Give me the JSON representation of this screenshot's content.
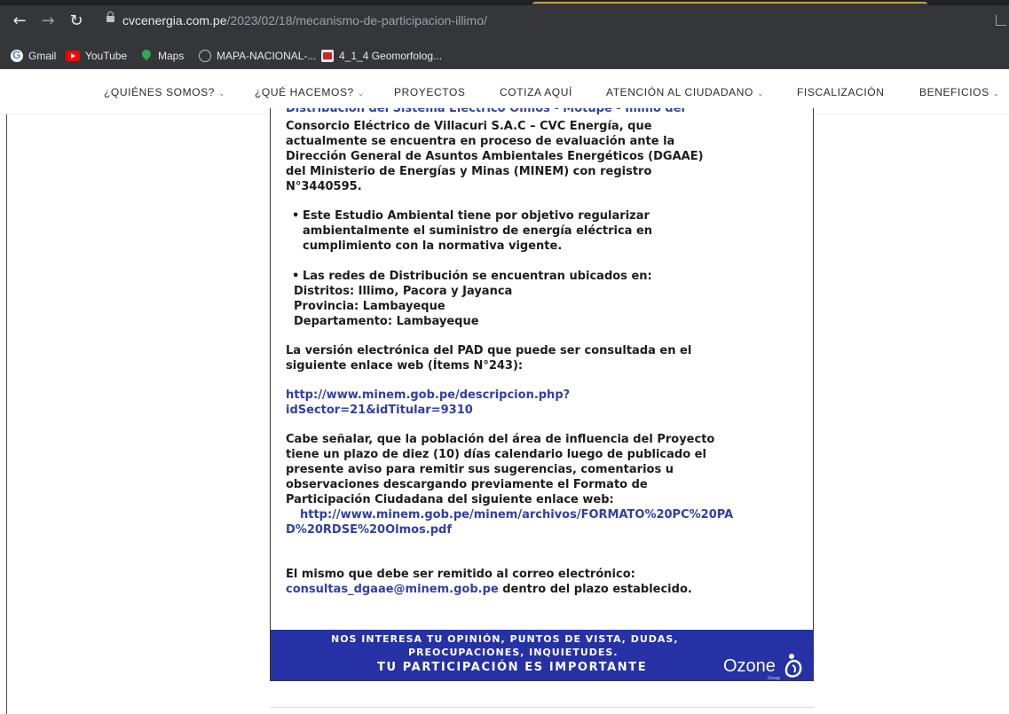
{
  "browser": {
    "url_host": "cvcenergia.com.pe",
    "url_path": "/2023/02/18/mecanismo-de-participacion-illimo/",
    "bookmarks": [
      {
        "label": "Gmail",
        "icon": "gmail-icon"
      },
      {
        "label": "YouTube",
        "icon": "youtube-icon"
      },
      {
        "label": "Maps",
        "icon": "maps-icon"
      },
      {
        "label": "MAPA-NACIONAL-...",
        "icon": "globe-icon"
      },
      {
        "label": "4_1_4 Geomorfolog...",
        "icon": "minem-icon"
      }
    ]
  },
  "nav": {
    "items": [
      {
        "label": "¿QUIÉNES SOMOS?",
        "dropdown": true
      },
      {
        "label": "¿QUÉ HACEMOS?",
        "dropdown": true
      },
      {
        "label": "PROYECTOS",
        "dropdown": false
      },
      {
        "label": "COTIZA AQUÍ",
        "dropdown": false
      },
      {
        "label": "ATENCIÓN AL CIUDADANO",
        "dropdown": true
      },
      {
        "label": "FISCALIZACIÓN",
        "dropdown": false
      },
      {
        "label": "BENEFICIOS",
        "dropdown": true
      }
    ],
    "chevron": "⌄"
  },
  "content": {
    "cut_line": "Distribución del Sistema Eléctrico Olmos - Motupe - Illimo del",
    "para1": [
      "Consorcio Eléctrico de Villacuri S.A.C – CVC Energía, que",
      "actualmente se encuentra en proceso de evaluación ante la",
      "Dirección General de Asuntos Ambientales Energéticos (DGAAE)",
      "del Ministerio de Energías y Minas (MINEM) con registro",
      "N°3440595."
    ],
    "bullet1": [
      "Este Estudio Ambiental tiene por objetivo regularizar",
      "ambientalmente el suministro de energía eléctrica en",
      "cumplimiento con la normativa vigente."
    ],
    "bullet2": [
      "Las redes de Distribución se encuentran ubicados en:",
      "Distritos: Illimo, Pacora y Jayanca",
      "Provincia: Lambayeque",
      "Departamento: Lambayeque"
    ],
    "para2": [
      "La versión electrónica del PAD que puede ser consultada en el",
      "siguiente enlace web (Ítems N°243):"
    ],
    "link1": [
      "http://www.minem.gob.pe/descripcion.php?",
      "idSector=21&idTitular=9310"
    ],
    "para3": [
      "Cabe señalar, que la población del área de influencia del Proyecto",
      "tiene un plazo de diez (10) días calendario luego de publicado el",
      "presente aviso para remitir sus sugerencias, comentarios u",
      "observaciones descargando previamente el Formato de",
      "Participación Ciudadana del siguiente enlace web:"
    ],
    "link2": [
      "http://www.minem.gob.pe/minem/archivos/FORMATO%20PC%20PA",
      "D%20RDSE%20Olmos.pdf"
    ],
    "para4": "El mismo que debe ser remitido al correo electrónico:",
    "email": "consultas_dgaae@minem.gob.pe",
    "email_suffix": " dentro del plazo establecido."
  },
  "banner": {
    "line1": "NOS INTERESA TU OPINIÓN, PUNTOS DE VISTA, DUDAS,",
    "line2": "PREOCUPACIONES, INQUIETUDES.",
    "line3": "TU PARTICIPACIÓN ES IMPORTANTE",
    "brand": "Ozone",
    "brand_sub": "Group"
  },
  "colors": {
    "chrome_bg": "#35363a",
    "link": "#2f3fa8",
    "banner_bg": "#2631a6"
  }
}
